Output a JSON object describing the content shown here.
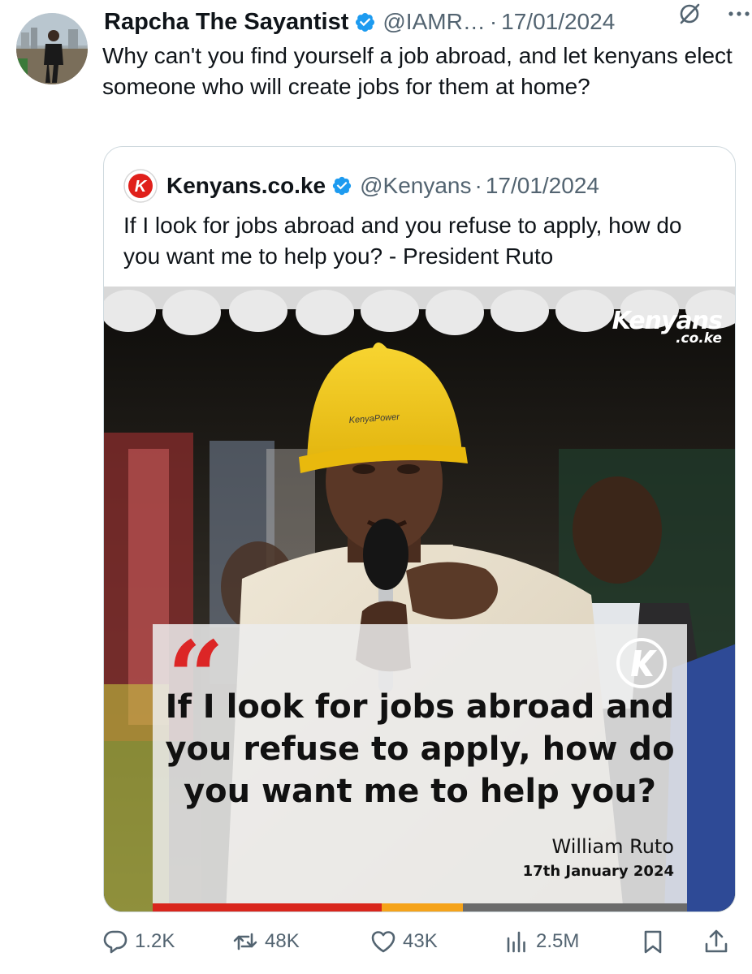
{
  "tweet": {
    "author": {
      "display_name": "Rapcha The Sayantist",
      "handle": "@IAMR…",
      "verified": true
    },
    "separator": "·",
    "date": "17/01/2024",
    "text": "Why can't you find yourself a job abroad, and let kenyans elect someone who will create jobs for them at home?"
  },
  "quoted_tweet": {
    "author": {
      "display_name": "Kenyans.co.ke",
      "handle": "@Kenyans",
      "verified": true,
      "logo_letter": "K"
    },
    "separator": "·",
    "date": "17/01/2024",
    "text": "If I look for jobs abroad and you refuse to apply, how do you want me to help you? - President Ruto",
    "media": {
      "watermark_line1": "Kenyans",
      "watermark_line2": ".co.ke",
      "hardhat_text": "KenyaPower",
      "quote_marks": "“",
      "quote_text": "If I look for jobs abroad and you refuse to apply, how do you want me to help you?",
      "speaker": "William Ruto",
      "speaker_date": "17th January 2024"
    }
  },
  "actions": {
    "replies": "1.2K",
    "reposts": "48K",
    "likes": "43K",
    "views": "2.5M"
  },
  "colors": {
    "verified_blue": "#1d9bf0",
    "secondary_text": "#536471",
    "quote_mark_red": "#dc2626",
    "hardhat_yellow": "#f2c418",
    "stripe_red": "#d9261c",
    "stripe_orange": "#f5a31a",
    "stripe_gray": "#6b6b6b"
  },
  "icons": [
    "grok-icon",
    "more-icon",
    "reply-icon",
    "repost-icon",
    "like-icon",
    "views-icon",
    "bookmark-icon",
    "share-icon"
  ]
}
